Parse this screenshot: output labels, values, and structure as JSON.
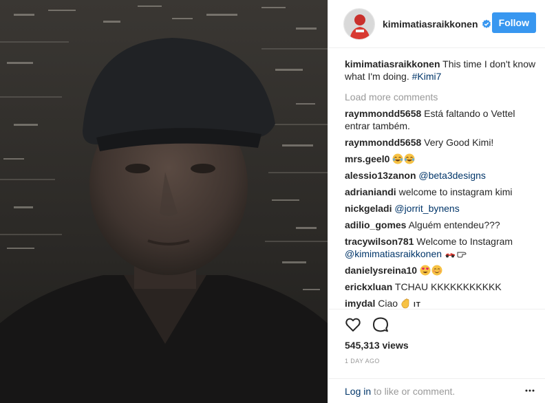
{
  "header": {
    "username": "kimimatiasraikkonen",
    "follow_label": "Follow"
  },
  "caption": {
    "username": "kimimatiasraikkonen",
    "text": "This time I don't know what I'm doing.",
    "hashtag": "#Kimi7"
  },
  "load_more": "Load more comments",
  "comments": [
    {
      "user": "raymmondd5658",
      "text": "Está faltando o Vettel entrar também."
    },
    {
      "user": "raymmondd5658",
      "text": "Very Good Kimi!"
    },
    {
      "user": "mrs.geel0",
      "text": ""
    },
    {
      "user": "alessio13zanon",
      "mention": "@beta3designs"
    },
    {
      "user": "adrianiandi",
      "text": "welcome to instagram kimi"
    },
    {
      "user": "nickgeladi",
      "mention": "@jorrit_bynens"
    },
    {
      "user": "adilio_gomes",
      "text": "Alguém entendeu???"
    },
    {
      "user": "tracywilson781",
      "text": "Welcome to Instagram",
      "mention": "@kimimatiasraikkonen"
    },
    {
      "user": "danielysreina10",
      "text": ""
    },
    {
      "user": "erickxluan",
      "text": "TCHAU KKKKKKKKKKK"
    },
    {
      "user": "imydal",
      "text": "Ciao",
      "suffix": "IT"
    }
  ],
  "views": "545,313 views",
  "timestamp": "1 day ago",
  "login": {
    "link": "Log in",
    "text": " to like or comment."
  },
  "colors": {
    "accent": "#3897f0",
    "link": "#003569",
    "muted": "#999999"
  },
  "icons": [
    "verified-badge-icon",
    "heart-icon",
    "comment-icon",
    "more-options-icon"
  ]
}
